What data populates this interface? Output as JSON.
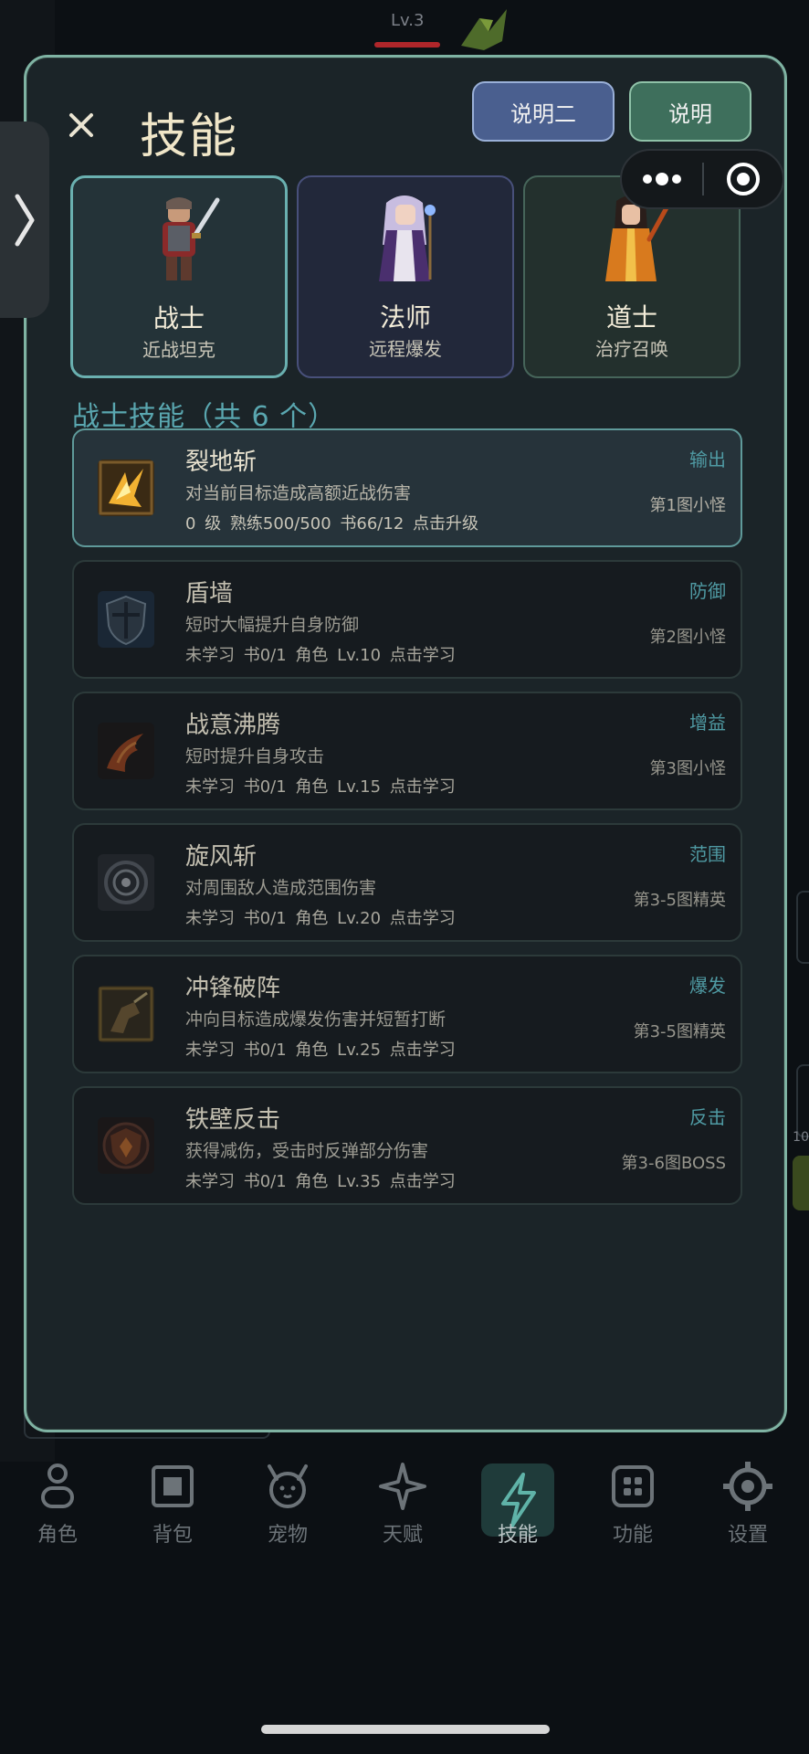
{
  "background": {
    "level_label": "Lv.3",
    "right_number": "10"
  },
  "panel": {
    "title": "技能",
    "close_label": "×",
    "header_buttons": [
      {
        "label": "说明二"
      },
      {
        "label": "说明"
      }
    ]
  },
  "classes": [
    {
      "name": "战士",
      "desc": "近战坦克",
      "selected": true
    },
    {
      "name": "法师",
      "desc": "远程爆发",
      "selected": false
    },
    {
      "name": "道士",
      "desc": "治疗召唤",
      "selected": false
    }
  ],
  "section_title": "战士技能（共 6 个）",
  "skills": [
    {
      "name": "裂地斩",
      "desc": "对当前目标造成高额近战伤害",
      "meta": "0 级  熟练500/500  书66/12  点击升级",
      "tag": "输出",
      "drop": "第1图小怪",
      "icon": "ground-slash-icon",
      "active": true
    },
    {
      "name": "盾墙",
      "desc": "短时大幅提升自身防御",
      "meta": "未学习  书0/1  角色 Lv.10  点击学习",
      "tag": "防御",
      "drop": "第2图小怪",
      "icon": "shield-wall-icon",
      "active": false
    },
    {
      "name": "战意沸腾",
      "desc": "短时提升自身攻击",
      "meta": "未学习  书0/1  角色 Lv.15  点击学习",
      "tag": "增益",
      "drop": "第3图小怪",
      "icon": "battle-rage-icon",
      "active": false
    },
    {
      "name": "旋风斩",
      "desc": "对周围敌人造成范围伤害",
      "meta": "未学习  书0/1  角色 Lv.20  点击学习",
      "tag": "范围",
      "drop": "第3-5图精英",
      "icon": "whirlwind-icon",
      "active": false
    },
    {
      "name": "冲锋破阵",
      "desc": "冲向目标造成爆发伤害并短暂打断",
      "meta": "未学习  书0/1  角色 Lv.25  点击学习",
      "tag": "爆发",
      "drop": "第3-5图精英",
      "icon": "charge-icon",
      "active": false
    },
    {
      "name": "铁壁反击",
      "desc": "获得减伤，受击时反弹部分伤害",
      "meta": "未学习  书0/1  角色 Lv.35  点击学习",
      "tag": "反击",
      "drop": "第3-6图BOSS",
      "icon": "iron-counter-icon",
      "active": false
    }
  ],
  "nav": [
    {
      "label": "角色",
      "icon": "person-icon"
    },
    {
      "label": "背包",
      "icon": "bag-icon"
    },
    {
      "label": "宠物",
      "icon": "pet-icon"
    },
    {
      "label": "天赋",
      "icon": "star-icon"
    },
    {
      "label": "技能",
      "icon": "lightning-icon",
      "active": true
    },
    {
      "label": "功能",
      "icon": "grid-icon"
    },
    {
      "label": "设置",
      "icon": "gear-icon"
    }
  ],
  "colors": {
    "accent": "#5aa7b0",
    "panel_border": "#7fb3a3",
    "panel_bg": "#1b2428"
  }
}
